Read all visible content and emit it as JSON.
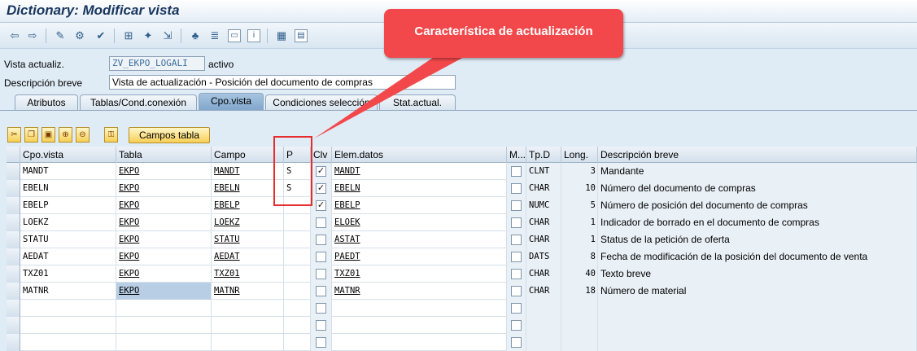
{
  "window": {
    "title": "Dictionary: Modificar vista"
  },
  "header_fields": {
    "view_label": "Vista actualiz.",
    "view_value": "ZV_EKPO_LOGALI",
    "view_status": "activo",
    "desc_label": "Descripción breve",
    "desc_value": "Vista de actualización - Posición del documento de compras"
  },
  "tabs": [
    {
      "label": "Atributos"
    },
    {
      "label": "Tablas/Cond.conexión"
    },
    {
      "label": "Cpo.vista"
    },
    {
      "label": "Condiciones selección"
    },
    {
      "label": "Stat.actual."
    }
  ],
  "table_toolbar": {
    "campos_button": "Campos tabla"
  },
  "annotation": {
    "callout_text": "Característica de actualización"
  },
  "columns": {
    "cpo_vista": "Cpo.vista",
    "tabla": "Tabla",
    "campo": "Campo",
    "p": "P",
    "clv": "Clv",
    "elem_datos": "Elem.datos",
    "m": "M...",
    "tp_d": "Tp.D",
    "long": "Long.",
    "desc": "Descripción breve"
  },
  "rows": [
    {
      "cpo": "MANDT",
      "tabla": "EKPO",
      "campo": "MANDT",
      "p": "S",
      "clv": true,
      "elem": "MANDT",
      "m": false,
      "tpd": "CLNT",
      "long": "3",
      "desc": "Mandante"
    },
    {
      "cpo": "EBELN",
      "tabla": "EKPO",
      "campo": "EBELN",
      "p": "S",
      "clv": true,
      "elem": "EBELN",
      "m": false,
      "tpd": "CHAR",
      "long": "10",
      "desc": "Número del documento de compras"
    },
    {
      "cpo": "EBELP",
      "tabla": "EKPO",
      "campo": "EBELP",
      "p": "",
      "clv": true,
      "elem": "EBELP",
      "m": false,
      "tpd": "NUMC",
      "long": "5",
      "desc": "Número de posición del documento de compras"
    },
    {
      "cpo": "LOEKZ",
      "tabla": "EKPO",
      "campo": "LOEKZ",
      "p": "",
      "clv": false,
      "elem": "ELOEK",
      "m": false,
      "tpd": "CHAR",
      "long": "1",
      "desc": "Indicador de borrado en el documento de compras"
    },
    {
      "cpo": "STATU",
      "tabla": "EKPO",
      "campo": "STATU",
      "p": "",
      "clv": false,
      "elem": "ASTAT",
      "m": false,
      "tpd": "CHAR",
      "long": "1",
      "desc": "Status de la petición de oferta"
    },
    {
      "cpo": "AEDAT",
      "tabla": "EKPO",
      "campo": "AEDAT",
      "p": "",
      "clv": false,
      "elem": "PAEDT",
      "m": false,
      "tpd": "DATS",
      "long": "8",
      "desc": "Fecha de modificación de la posición del documento de venta"
    },
    {
      "cpo": "TXZ01",
      "tabla": "EKPO",
      "campo": "TXZ01",
      "p": "",
      "clv": false,
      "elem": "TXZ01",
      "m": false,
      "tpd": "CHAR",
      "long": "40",
      "desc": "Texto breve"
    },
    {
      "cpo": "MATNR",
      "tabla": "EKPO",
      "campo": "MATNR",
      "p": "",
      "clv": false,
      "elem": "MATNR",
      "m": false,
      "tpd": "CHAR",
      "long": "18",
      "desc": "Número de material"
    },
    {
      "cpo": "",
      "tabla": "",
      "campo": "",
      "p": "",
      "clv": false,
      "elem": "",
      "m": false,
      "tpd": "",
      "long": "",
      "desc": ""
    },
    {
      "cpo": "",
      "tabla": "",
      "campo": "",
      "p": "",
      "clv": false,
      "elem": "",
      "m": false,
      "tpd": "",
      "long": "",
      "desc": ""
    },
    {
      "cpo": "",
      "tabla": "",
      "campo": "",
      "p": "",
      "clv": false,
      "elem": "",
      "m": false,
      "tpd": "",
      "long": "",
      "desc": ""
    },
    {
      "cpo": "",
      "tabla": "",
      "campo": "",
      "p": "",
      "clv": false,
      "elem": "",
      "m": false,
      "tpd": "",
      "long": "",
      "desc": ""
    }
  ]
}
